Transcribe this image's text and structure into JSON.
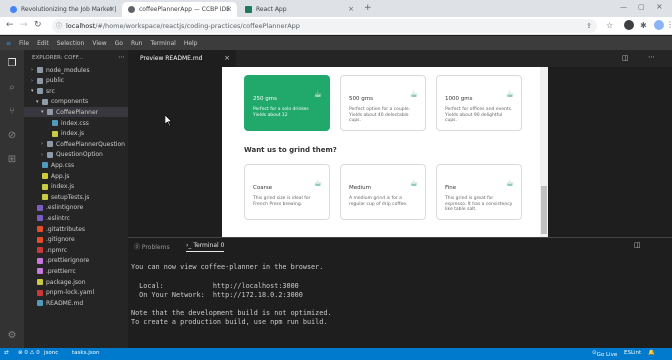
{
  "browser": {
    "tabs": [
      {
        "label": "Revolutionizing the Job Market |",
        "favicon_color": "#4285f4"
      },
      {
        "label": "coffeePlannerApp — CCBP IDE",
        "favicon_color": "#5f6368"
      },
      {
        "label": "React App",
        "favicon_color": "#1f7a5c"
      }
    ],
    "new_tab": "+",
    "address": {
      "host": "localhost",
      "path": "/#/home/workspace/reactjs/coding-practices/coffeePlannerApp"
    }
  },
  "menu": [
    "File",
    "Edit",
    "Selection",
    "View",
    "Go",
    "Run",
    "Terminal",
    "Help"
  ],
  "explorer": {
    "title": "EXPLORER: COFF...",
    "items": [
      {
        "label": "node_modules",
        "type": "folder",
        "depth": 1,
        "color": "#8d9aa8"
      },
      {
        "label": "public",
        "type": "folder",
        "depth": 1,
        "color": "#8d9aa8"
      },
      {
        "label": "src",
        "type": "folder-open",
        "depth": 1,
        "color": "#8d9aa8"
      },
      {
        "label": "components",
        "type": "folder-open",
        "depth": 2,
        "color": "#8d9aa8"
      },
      {
        "label": "CoffeePlanner",
        "type": "folder-open",
        "depth": 3,
        "color": "#8d9aa8",
        "selected": true
      },
      {
        "label": "index.css",
        "type": "file",
        "depth": 4,
        "color": "#519aba"
      },
      {
        "label": "index.js",
        "type": "file",
        "depth": 4,
        "color": "#cbcb41"
      },
      {
        "label": "CoffeePlannerQuestion",
        "type": "folder",
        "depth": 3,
        "color": "#8d9aa8"
      },
      {
        "label": "QuestionOption",
        "type": "folder",
        "depth": 3,
        "color": "#8d9aa8"
      },
      {
        "label": "App.css",
        "type": "file",
        "depth": 2,
        "color": "#519aba"
      },
      {
        "label": "App.js",
        "type": "file",
        "depth": 2,
        "color": "#cbcb41"
      },
      {
        "label": "index.js",
        "type": "file",
        "depth": 2,
        "color": "#cbcb41"
      },
      {
        "label": "setupTests.js",
        "type": "file",
        "depth": 2,
        "color": "#cbcb41"
      },
      {
        "label": ".eslintignore",
        "type": "file",
        "depth": 1,
        "color": "#7b5fc0"
      },
      {
        "label": ".eslintrc",
        "type": "file",
        "depth": 1,
        "color": "#7b5fc0"
      },
      {
        "label": ".gitattributes",
        "type": "file",
        "depth": 1,
        "color": "#e44d26"
      },
      {
        "label": ".gitignore",
        "type": "file",
        "depth": 1,
        "color": "#e44d26"
      },
      {
        "label": ".npmrc",
        "type": "file",
        "depth": 1,
        "color": "#cb3837"
      },
      {
        "label": ".prettierignore",
        "type": "file",
        "depth": 1,
        "color": "#c678dd"
      },
      {
        "label": ".prettierrc",
        "type": "file",
        "depth": 1,
        "color": "#c678dd"
      },
      {
        "label": "package.json",
        "type": "file",
        "depth": 1,
        "color": "#cbcb41"
      },
      {
        "label": "pnpm-lock.yaml",
        "type": "file",
        "depth": 1,
        "color": "#cb3837"
      },
      {
        "label": "README.md",
        "type": "file",
        "depth": 1,
        "color": "#519aba"
      }
    ]
  },
  "editor": {
    "tab_label": "Preview README.md"
  },
  "preview": {
    "quantity_cards": [
      {
        "title": "250 gms",
        "desc": "Perfect for a solo drinker. Yields about 12",
        "selected": true
      },
      {
        "title": "500 gms",
        "desc": "Perfect option for a couple. Yields about 40 delectable cups.",
        "selected": false
      },
      {
        "title": "1000 gms",
        "desc": "Perfect for offices and events. Yields about 90 delightful cups.",
        "selected": false
      }
    ],
    "grind_heading": "Want us to grind them?",
    "grind_cards": [
      {
        "title": "Coarse",
        "desc": "This grind size is ideal for French Press brewing."
      },
      {
        "title": "Medium",
        "desc": "A medium grind is for a regular cup of drip coffee."
      },
      {
        "title": "Fine",
        "desc": "This grind is great for espresso. It has a consistency like table salt."
      }
    ]
  },
  "panel": {
    "tabs": [
      "Problems",
      "Terminal 0"
    ],
    "terminal_lines": [
      {
        "text": "You can now view coffee-planner in the browser."
      },
      {
        "text": ""
      },
      {
        "text": "  Local:            http://localhost:3000"
      },
      {
        "text": "  On Your Network:  http://172.18.0.2:3000"
      },
      {
        "text": ""
      },
      {
        "text": "Note that the development build is not optimized."
      },
      {
        "text": "To create a production build, use npm run build."
      }
    ]
  },
  "status": {
    "left": [
      "⊗ 0 ⚠ 0",
      "jsonc",
      "tasks.json"
    ],
    "right": [
      "Go Live",
      "ESLint"
    ]
  },
  "colors": {
    "accent": "#007acc",
    "card_green": "#21a86b"
  }
}
